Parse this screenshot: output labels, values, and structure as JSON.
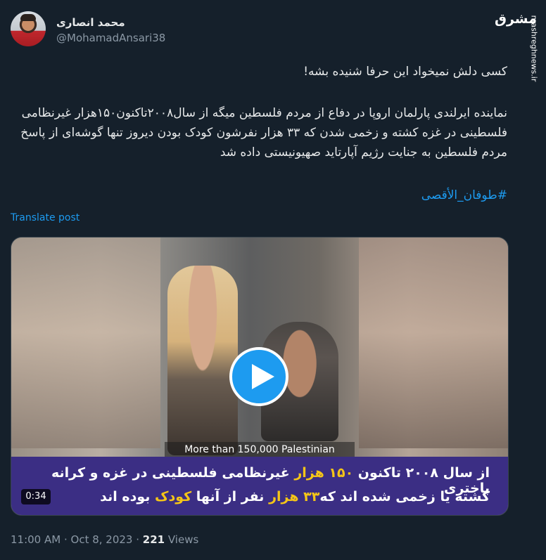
{
  "author": {
    "display_name": "محمد انصاری",
    "handle": "@MohamadAnsari38"
  },
  "watermark": {
    "logo_text": "مشرق",
    "url": "mashreghnews.ir"
  },
  "tweet": {
    "line1": "کسی دلش نمیخواد این حرفا شنیده بشه!",
    "paragraph": "نماینده ایرلندی پارلمان اروپا در دفاع از مردم فلسطین میگه از سال۲۰۰۸تاکنون۱۵۰هزار غیرنظامی فلسطینی در غزه کشته و زخمی شدن که ۳۳ هزار نفرشون کودک بودن دیروز تنها گوشه‌ای از پاسخ مردم فلسطین به جنایت رژیم آپارتاید صهیونیستی داده شد",
    "hashtag": "#طوفان_الأقصی",
    "translate_label": "Translate post"
  },
  "video": {
    "caption_english": "More than 150,000 Palestinian",
    "subtitle_line1_a": "از سال ۲۰۰۸ تاکنون ",
    "subtitle_line1_hl": "۱۵۰ هزار",
    "subtitle_line1_b": " غیرنظامی فلسطینی در غزه و کرانه باختری",
    "subtitle_line2_a": "کشته یا زخمی شده اند که",
    "subtitle_line2_hl1": "۳۳ هزار",
    "subtitle_line2_b": " نفر از آنها ",
    "subtitle_line2_hl2": "کودک",
    "subtitle_line2_c": " بوده اند",
    "duration": "0:34"
  },
  "meta": {
    "time": "11:00 AM",
    "separator": " · ",
    "date": "Oct 8, 2023",
    "views_count": "221",
    "views_label": " Views"
  },
  "colors": {
    "background": "#15202b",
    "accent": "#1d9bf0",
    "subtitle_bg": "#3b2e84",
    "subtitle_highlight": "#f4c518"
  }
}
